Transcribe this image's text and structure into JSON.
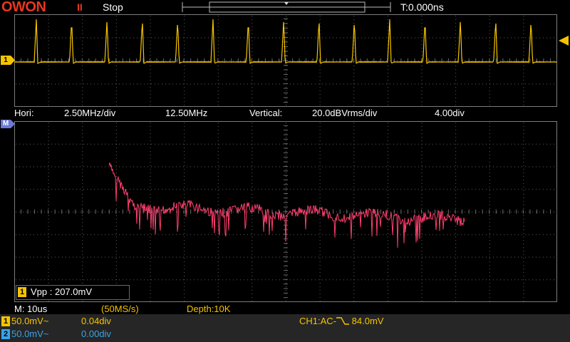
{
  "header": {
    "brand": "OWON",
    "run_indicator": "II",
    "run_state": "Stop",
    "trigger_marker": "T",
    "time_offset": "T:0.000ns"
  },
  "markers": {
    "ch1": "1",
    "math": "M"
  },
  "hori_bar": {
    "hori_label": "Hori:",
    "hori_scale": "2.50MHz/div",
    "hori_center": "12.50MHz",
    "vert_label": "Vertical:",
    "vert_scale": "20.0dBVrms/div",
    "vert_pos": "4.00div"
  },
  "measurement": {
    "channel": "1",
    "text": "Vpp : 207.0mV"
  },
  "status": {
    "timebase": "M: 10us",
    "sample_rate": "(50MS/s)",
    "depth": "Depth:10K"
  },
  "channels": [
    {
      "id": "1",
      "scale": "50.0mV~",
      "pos": "0.04div"
    },
    {
      "id": "2",
      "scale": "50.0mV~",
      "pos": "0.00div"
    }
  ],
  "trigger": {
    "text_prefix": "CH1:AC-",
    "edge_symbol": "┐",
    "level": "84.0mV"
  },
  "colors": {
    "ch1": "#f5c400",
    "ch2": "#3aa3e8",
    "fft": "#ff3f6e",
    "brand": "#e8371f"
  }
}
